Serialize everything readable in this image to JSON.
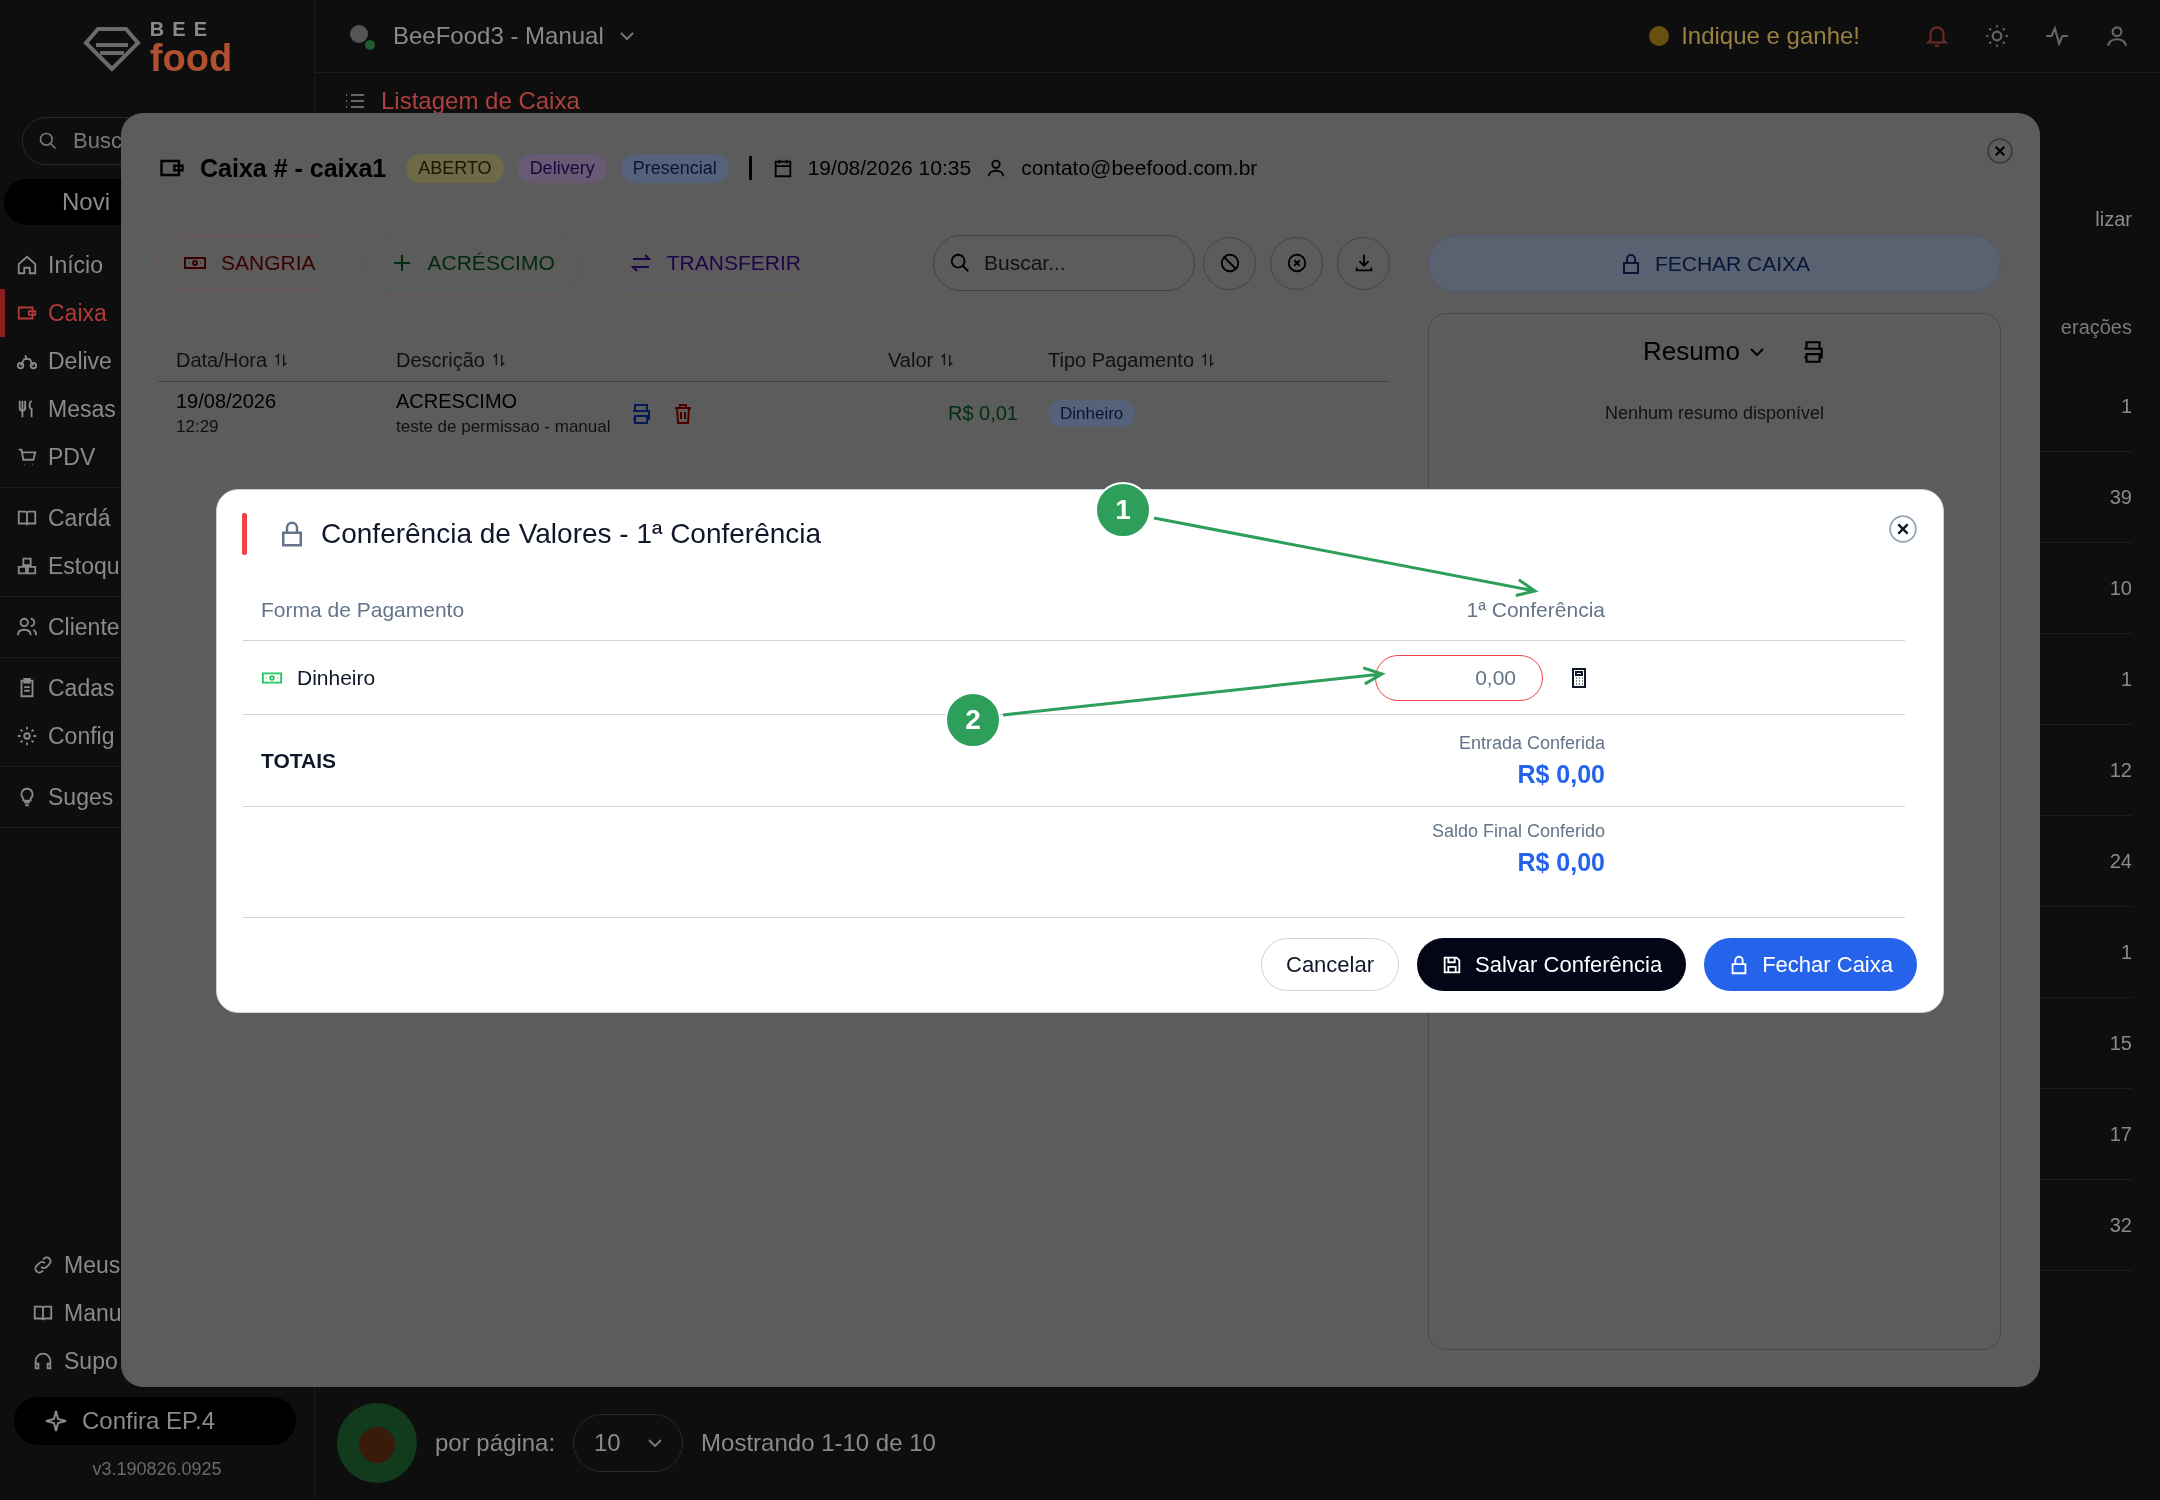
{
  "app": {
    "logo": {
      "top": "BEE",
      "bottom": "food"
    },
    "store": "BeeFood3 - Manual",
    "page_title": "Listagem de Caixa",
    "referral": "Indique e ganhe!",
    "sidebar": {
      "search_placeholder": "Busc",
      "news_button": "Novi",
      "groups": [
        {
          "items": [
            {
              "label": "Início",
              "selected": false
            },
            {
              "label": "Caixa",
              "selected": true
            },
            {
              "label": "Delive",
              "selected": false
            },
            {
              "label": "Mesas",
              "selected": false
            },
            {
              "label": "PDV",
              "selected": false
            }
          ]
        },
        {
          "items": [
            {
              "label": "Cardá",
              "selected": false
            },
            {
              "label": "Estoqu",
              "selected": false
            }
          ]
        },
        {
          "items": [
            {
              "label": "Cliente",
              "selected": false
            }
          ]
        },
        {
          "items": [
            {
              "label": "Cadas",
              "selected": false
            },
            {
              "label": "Config",
              "selected": false
            }
          ]
        },
        {
          "items": [
            {
              "label": "Suges",
              "selected": false
            }
          ]
        }
      ],
      "footer_items": [
        "Meus",
        "Manu",
        "Supo"
      ],
      "promo_button": "Confira EP.4",
      "version": "v3.190826.0925"
    },
    "list": {
      "action": "lizar",
      "column_header": "erações",
      "values": [
        "1",
        "39",
        "10",
        "1",
        "12",
        "24",
        "1",
        "15",
        "17",
        "32"
      ]
    },
    "pagination": {
      "per_page_label": "por página:",
      "per_page": "10",
      "summary": "Mostrando 1-10 de 10"
    }
  },
  "cash_panel": {
    "title": "Caixa # - caixa1",
    "badges": [
      {
        "label": "ABERTO",
        "kind": "status"
      },
      {
        "label": "Delivery",
        "kind": "delivery"
      },
      {
        "label": "Presencial",
        "kind": "presencial"
      }
    ],
    "date": "19/08/2026 10:35",
    "user": "contato@beefood.com.br",
    "actions": [
      {
        "label": "SANGRIA",
        "kind": "withdrawal"
      },
      {
        "label": "ACRÉSCIMO",
        "kind": "addition"
      },
      {
        "label": "TRANSFERIR",
        "kind": "transfer"
      }
    ],
    "search": {
      "placeholder": "Buscar..."
    },
    "close_button": "FECHAR CAIXA",
    "table": {
      "columns": [
        "Data/Hora",
        "Descrição",
        "Valor",
        "Tipo Pagamento"
      ],
      "rows": [
        {
          "date": "19/08/2026",
          "time": "12:29",
          "description": "ACRESCIMO",
          "note": "teste de permissao - manual",
          "value": "R$ 0,01",
          "payment": "Dinheiro"
        }
      ]
    },
    "summary": {
      "title": "Resumo",
      "empty": "Nenhum resumo disponível"
    }
  },
  "dialog": {
    "title": "Conferência de Valores - 1ª Conferência",
    "columns": [
      "Forma de Pagamento",
      "1ª Conferência"
    ],
    "rows": [
      {
        "method": "Dinheiro",
        "placeholder": "0,00",
        "error": true
      }
    ],
    "totals_label": "TOTAIS",
    "totals": [
      {
        "label": "Entrada Conferida",
        "value": "R$ 0,00"
      },
      {
        "label": "Saldo Final Conferido",
        "value": "R$ 0,00"
      }
    ],
    "buttons": [
      {
        "label": "Cancelar",
        "kind": "secondary"
      },
      {
        "label": "Salvar Conferência",
        "kind": "save"
      },
      {
        "label": "Fechar Caixa",
        "kind": "primary"
      }
    ]
  },
  "annotations": [
    {
      "label": "1"
    },
    {
      "label": "2"
    }
  ]
}
